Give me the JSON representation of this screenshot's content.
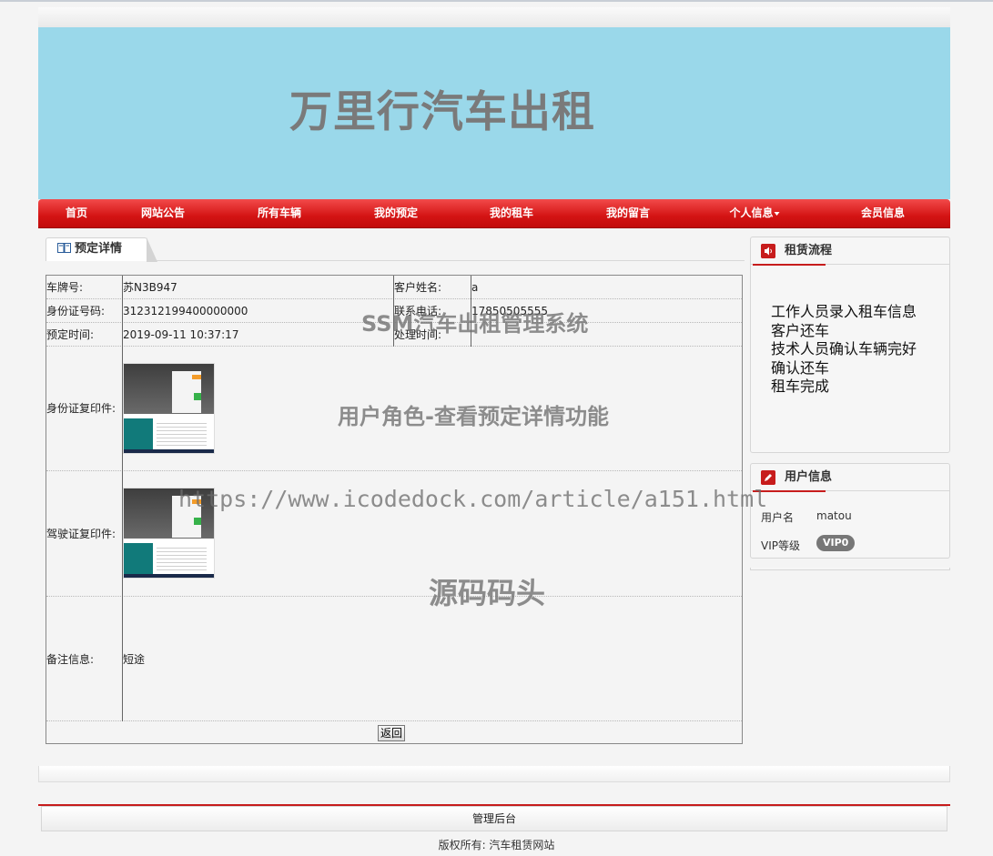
{
  "banner": {
    "title": "万里行汽车出租"
  },
  "nav": {
    "items": [
      "首页",
      "网站公告",
      "所有车辆",
      "我的预定",
      "我的租车",
      "我的留言",
      "个人信息",
      "会员信息"
    ]
  },
  "tab": {
    "label": "预定详情"
  },
  "details": {
    "plate_label": "车牌号:",
    "plate_value": "苏N3B947",
    "customer_label": "客户姓名:",
    "customer_value": "a",
    "id_label": "身份证号码:",
    "id_value": "312312199400000000",
    "phone_label": "联系电话:",
    "phone_value": "17850505555",
    "reserve_label": "预定时间:",
    "reserve_value": "2019-09-11 10:37:17",
    "process_label": "处理时间:",
    "process_value": "",
    "id_copy_label": "身份证复印件:",
    "license_copy_label": "驾驶证复印件:",
    "remark_label": "备注信息:",
    "remark_value": "短途",
    "back_button": "返回"
  },
  "sidebar": {
    "flow_title": "租赁流程",
    "flow_steps": [
      "工作人员录入租车信息",
      "客户还车",
      "技术人员确认车辆完好",
      "确认还车",
      "租车完成"
    ],
    "user_title": "用户信息",
    "username_label": "用户名",
    "username_value": "matou",
    "vip_label": "VIP等级",
    "vip_value": "VIP0"
  },
  "watermarks": {
    "system": "SSM汽车出租管理系统",
    "feature": "用户角色-查看预定详情功能",
    "url": "https://www.icodedock.com/article/a151.html",
    "brand": "源码码头"
  },
  "footer": {
    "admin": "管理后台",
    "copyright": "版权所有: 汽车租赁网站"
  }
}
